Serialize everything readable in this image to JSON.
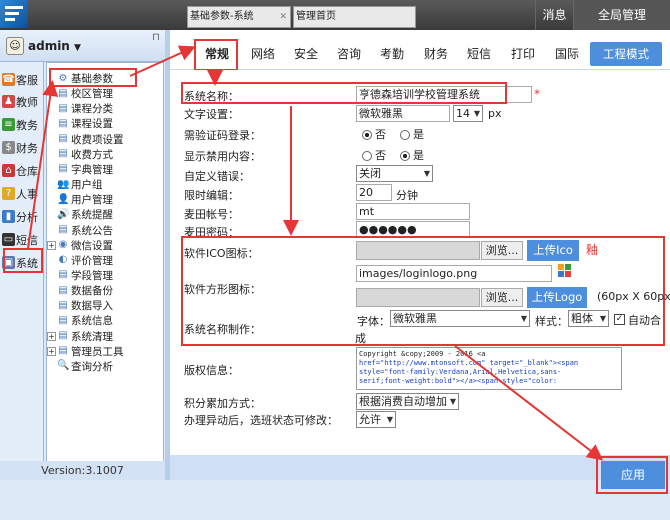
{
  "topbar": {
    "tabs": [
      {
        "label": "基础参数-系统"
      },
      {
        "label": "管理首页"
      }
    ],
    "messages_label": "消息",
    "fullscreen_label": "全局管理"
  },
  "user": {
    "name": "admin"
  },
  "left_nav": {
    "items": [
      {
        "label": "客服",
        "icon": "headset-icon"
      },
      {
        "label": "教师",
        "icon": "teacher-icon"
      },
      {
        "label": "教务",
        "icon": "book-icon"
      },
      {
        "label": "财务",
        "icon": "money-icon"
      },
      {
        "label": "仓库",
        "icon": "warehouse-icon"
      },
      {
        "label": "人事",
        "icon": "people-icon"
      },
      {
        "label": "分析",
        "icon": "chart-icon"
      },
      {
        "label": "短信",
        "icon": "sms-icon"
      },
      {
        "label": "系统",
        "icon": "system-icon"
      }
    ]
  },
  "tree": {
    "items": [
      {
        "label": "基础参数",
        "expander": "",
        "icon": "gear-icon"
      },
      {
        "label": "校区管理",
        "expander": "",
        "icon": "campus-icon"
      },
      {
        "label": "课程分类",
        "expander": "",
        "icon": "category-icon"
      },
      {
        "label": "课程设置",
        "expander": "",
        "icon": "course-icon"
      },
      {
        "label": "收费项设置",
        "expander": "",
        "icon": "fee-item-icon"
      },
      {
        "label": "收费方式",
        "expander": "",
        "icon": "payment-icon"
      },
      {
        "label": "字典管理",
        "expander": "",
        "icon": "dictionary-icon"
      },
      {
        "label": "用户组",
        "expander": "",
        "icon": "user-group-icon"
      },
      {
        "label": "用户管理",
        "expander": "",
        "icon": "user-icon"
      },
      {
        "label": "系统提醒",
        "expander": "",
        "icon": "bell-icon"
      },
      {
        "label": "系统公告",
        "expander": "",
        "icon": "notice-icon"
      },
      {
        "label": "微信设置",
        "expander": "+",
        "icon": "wechat-icon"
      },
      {
        "label": "评价管理",
        "expander": "",
        "icon": "rating-icon"
      },
      {
        "label": "学段管理",
        "expander": "",
        "icon": "stage-icon"
      },
      {
        "label": "数据备份",
        "expander": "",
        "icon": "backup-icon"
      },
      {
        "label": "数据导入",
        "expander": "",
        "icon": "import-icon"
      },
      {
        "label": "系统信息",
        "expander": "",
        "icon": "info-icon"
      },
      {
        "label": "系统清理",
        "expander": "+",
        "icon": "cleanup-icon"
      },
      {
        "label": "管理员工具",
        "expander": "+",
        "icon": "tool-icon"
      },
      {
        "label": "查询分析",
        "expander": "",
        "icon": "search-icon"
      }
    ]
  },
  "version": "Version:3.1007",
  "settings_tabs": [
    {
      "label": "常规"
    },
    {
      "label": "网络"
    },
    {
      "label": "安全"
    },
    {
      "label": "咨询"
    },
    {
      "label": "考勤"
    },
    {
      "label": "财务"
    },
    {
      "label": "短信"
    },
    {
      "label": "打印"
    },
    {
      "label": "国际"
    }
  ],
  "mode_button": "工程模式",
  "form": {
    "system_name": {
      "label": "系统名称：",
      "value": "亨德森培训学校管理系统",
      "required": "*"
    },
    "text_settings": {
      "label": "文字设置：",
      "font": "微软雅黑",
      "size": "14",
      "unit": "px"
    },
    "captcha": {
      "label": "需验证码登录：",
      "options": [
        "否",
        "是"
      ],
      "selected": "否"
    },
    "show_disabled": {
      "label": "显示禁用内容：",
      "options": [
        "否",
        "是"
      ],
      "selected": "是"
    },
    "custom_error": {
      "label": "自定义错误：",
      "value": "关闭"
    },
    "edit_limit": {
      "label": "限时编辑：",
      "value": "20",
      "unit": "分钟"
    },
    "maitian_account": {
      "label": "麦田帐号：",
      "value": "mt"
    },
    "maitian_password": {
      "label": "麦田密码：",
      "value": "●●●●●●"
    },
    "ico": {
      "label": "软件ICO图标：",
      "browse": "浏览...",
      "upload": "上传Ico",
      "note": "釉"
    },
    "square_icon": {
      "label": "软件方形图标：",
      "path": "images/loginlogo.png",
      "browse": "浏览...",
      "upload": "上传Logo",
      "size_hint": "(60px X 60px"
    },
    "name_make": {
      "label": "系统名称制作：",
      "font_label": "字体：",
      "font": "微软雅黑",
      "style_label": "样式：",
      "style": "粗体",
      "auto_label": "自动合成"
    },
    "copyright": {
      "label": "版权信息：",
      "lines": [
        "Copyright &copy;2009 - 2016 <a",
        "href=\"http://www.mtonsoft.com\" target=\"_blank\"><span",
        "style=\"font-family:Verdana,Arial,Helvetica,sans-",
        "serif;font-weight:bold\"></a><span style=\"color:"
      ]
    },
    "points_mode": {
      "label": "积分累加方式：",
      "value": "根据消费自动增加"
    },
    "class_status": {
      "label": "办理异动后，选班状态可修改：",
      "value": "允许"
    }
  },
  "apply_button": "应用",
  "colors": {
    "accent": "#4d8fdc",
    "highlight": "#e53535",
    "topbar": "#4a4a4a"
  }
}
